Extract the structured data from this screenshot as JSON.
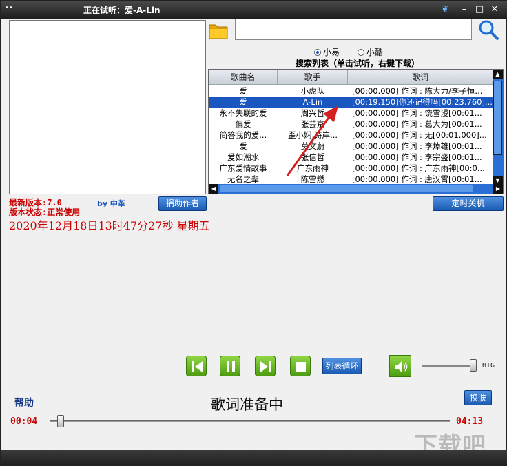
{
  "window": {
    "title": "正在试听：爱-A-Lin",
    "app_icon": "••"
  },
  "titlebar_buttons": {
    "skin_icon": "❦",
    "min": "–",
    "max": "□",
    "close": "✕"
  },
  "search": {
    "value": "",
    "placeholder": ""
  },
  "sources": [
    {
      "label": "小易",
      "selected": true
    },
    {
      "label": "小酷",
      "selected": false
    }
  ],
  "list_caption": "搜索列表（单击试听，右键下载）",
  "table": {
    "headers": [
      "歌曲名",
      "歌手",
      "歌词"
    ],
    "rows": [
      {
        "song": "爱",
        "artist": "小虎队",
        "lyric": "[00:00.000] 作词 : 陈大力/李子恒..."
      },
      {
        "song": "爱",
        "artist": "A-Lin",
        "lyric": "[00:19.150]你还记得吗[00:23.760]..."
      },
      {
        "song": "永不失联的爱",
        "artist": "周兴哲",
        "lyric": "[00:00.000] 作词 : 饶雪漫[00:01..."
      },
      {
        "song": "偏爱",
        "artist": "张芸京",
        "lyric": "[00:00.000] 作词 : 葛大为[00:01..."
      },
      {
        "song": "简答我的爱...",
        "artist": "歪小娴,诗岸...",
        "lyric": "[00:00.000] 作词 : 无[00:01.000]..."
      },
      {
        "song": "爱",
        "artist": "莫文蔚",
        "lyric": "[00:00.000] 作词 : 李焯雄[00:01..."
      },
      {
        "song": "爱如潮水",
        "artist": "张信哲",
        "lyric": "[00:00.000] 作词 : 李宗盛[00:01..."
      },
      {
        "song": "广东爱情故事",
        "artist": "广东雨神",
        "lyric": "[00:00.000] 作词 : 广东雨神[00:0..."
      },
      {
        "song": "无名之辈",
        "artist": "陈雪燃",
        "lyric": "[00:00.000] 作词 : 唐汉霄[00:01..."
      }
    ]
  },
  "info": {
    "version": "最新版本:7.0",
    "status": "版本状态:正常使用",
    "by": "by 中革",
    "datetime": "2020年12月18日13时47分27秒  星期五"
  },
  "buttons": {
    "donate": "捐助作者",
    "timer": "定时关机",
    "loop": "列表循环",
    "skin": "换肤",
    "help": "帮助"
  },
  "player": {
    "lyric_status": "歌词准备中",
    "current_time": "00:04",
    "total_time": "04:13",
    "progress_fraction": 0.016,
    "volume_label": "HIG",
    "volume_fraction": 0.95
  },
  "colors": {
    "accent_blue": "#1a56c0",
    "button_green": "#5fb31a",
    "text_red": "#cc0000"
  },
  "watermark": "下载吧"
}
